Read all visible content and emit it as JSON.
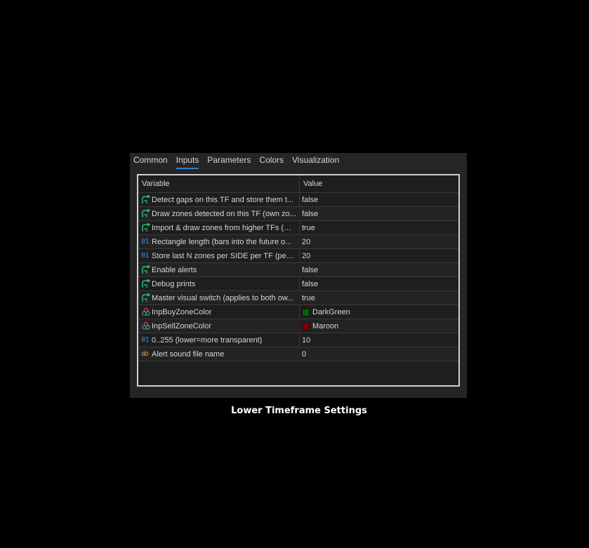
{
  "tabs": [
    {
      "label": "Common"
    },
    {
      "label": "Inputs"
    },
    {
      "label": "Parameters"
    },
    {
      "label": "Colors"
    },
    {
      "label": "Visualization"
    }
  ],
  "active_tab": "Inputs",
  "table": {
    "headers": {
      "variable": "Variable",
      "value": "Value"
    },
    "rows": [
      {
        "icon": "bool-icon",
        "name": "Detect gaps on this TF and store them t...",
        "value": "false"
      },
      {
        "icon": "bool-icon",
        "name": "Draw zones detected on this TF (own zo...",
        "value": "false"
      },
      {
        "icon": "bool-icon",
        "name": "Import & draw zones from higher TFs (GV)",
        "value": "true"
      },
      {
        "icon": "int-icon",
        "name": "Rectangle length (bars into the future o...",
        "value": "20"
      },
      {
        "icon": "int-icon",
        "name": "Store last N zones per SIDE per TF (per ...",
        "value": "20"
      },
      {
        "icon": "bool-icon",
        "name": "Enable alerts",
        "value": "false"
      },
      {
        "icon": "bool-icon",
        "name": "Debug prints",
        "value": "false"
      },
      {
        "icon": "bool-icon",
        "name": "Master visual switch (applies to both ow...",
        "value": "true"
      },
      {
        "icon": "color-icon",
        "name": "InpBuyZoneColor",
        "value": "DarkGreen",
        "swatch": "#006400"
      },
      {
        "icon": "color-icon",
        "name": "InpSellZoneColor",
        "value": "Maroon",
        "swatch": "#800000"
      },
      {
        "icon": "int-icon",
        "name": "0..255 (lower=more transparent)",
        "value": "10"
      },
      {
        "icon": "string-icon",
        "name": "Alert sound file name",
        "value": "0"
      }
    ]
  },
  "caption": "Lower Timeframe Settings",
  "icon_glyphs": {
    "int-icon": "01",
    "string-icon": "ab"
  },
  "colors": {
    "accent": "#2f7fd4",
    "bool_icon": "#2fbf71"
  }
}
